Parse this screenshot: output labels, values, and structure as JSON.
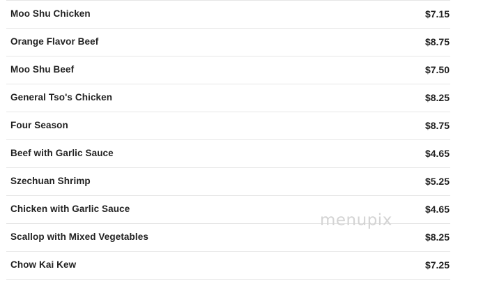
{
  "menu": {
    "items": [
      {
        "name": "Moo Shu Chicken",
        "price": "$7.15"
      },
      {
        "name": "Orange Flavor Beef",
        "price": "$8.75"
      },
      {
        "name": "Moo Shu Beef",
        "price": "$7.50"
      },
      {
        "name": "General Tso's Chicken",
        "price": "$8.25"
      },
      {
        "name": "Four Season",
        "price": "$8.75"
      },
      {
        "name": "Beef with Garlic Sauce",
        "price": "$4.65"
      },
      {
        "name": "Szechuan Shrimp",
        "price": "$5.25"
      },
      {
        "name": "Chicken with Garlic Sauce",
        "price": "$4.65"
      },
      {
        "name": "Scallop with Mixed Vegetables",
        "price": "$8.25"
      },
      {
        "name": "Chow Kai Kew",
        "price": "$7.25"
      }
    ]
  },
  "watermark": {
    "text": "menupix"
  }
}
